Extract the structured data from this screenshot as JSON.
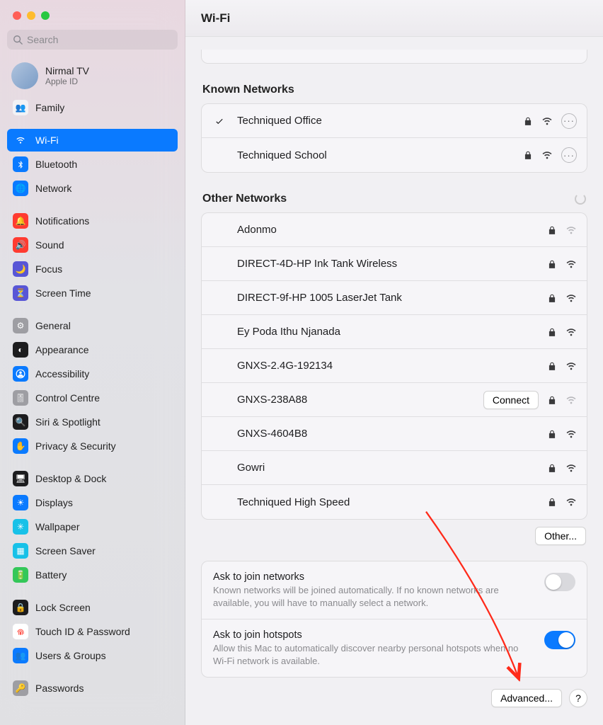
{
  "header": {
    "title": "Wi-Fi"
  },
  "search": {
    "placeholder": "Search"
  },
  "profile": {
    "name": "Nirmal TV",
    "sub": "Apple ID"
  },
  "sidebar": {
    "groups": [
      [
        {
          "label": "Family",
          "bg": "#f2f2f5",
          "fg": "#0a7aff",
          "glyph": "👥"
        }
      ],
      [
        {
          "label": "Wi-Fi",
          "bg": "#0a7aff",
          "glyph": "wifi",
          "selected": true
        },
        {
          "label": "Bluetooth",
          "bg": "#0a7aff",
          "glyph": "bt"
        },
        {
          "label": "Network",
          "bg": "#0a7aff",
          "glyph": "🌐"
        }
      ],
      [
        {
          "label": "Notifications",
          "bg": "#ff3b30",
          "glyph": "🔔"
        },
        {
          "label": "Sound",
          "bg": "#ff3b30",
          "glyph": "🔊"
        },
        {
          "label": "Focus",
          "bg": "#5856d6",
          "glyph": "🌙"
        },
        {
          "label": "Screen Time",
          "bg": "#5856d6",
          "glyph": "⏳"
        }
      ],
      [
        {
          "label": "General",
          "bg": "#9e9ea3",
          "glyph": "⚙︎"
        },
        {
          "label": "Appearance",
          "bg": "#1c1c1e",
          "glyph": "◐"
        },
        {
          "label": "Accessibility",
          "bg": "#0a7aff",
          "glyph": "person"
        },
        {
          "label": "Control Centre",
          "bg": "#9e9ea3",
          "glyph": "🎚"
        },
        {
          "label": "Siri & Spotlight",
          "bg": "#1c1c1e",
          "glyph": "🔍"
        },
        {
          "label": "Privacy & Security",
          "bg": "#0a7aff",
          "glyph": "✋"
        }
      ],
      [
        {
          "label": "Desktop & Dock",
          "bg": "#1c1c1e",
          "glyph": "🖥"
        },
        {
          "label": "Displays",
          "bg": "#0a7aff",
          "glyph": "☀︎"
        },
        {
          "label": "Wallpaper",
          "bg": "#17c1e8",
          "glyph": "✳︎"
        },
        {
          "label": "Screen Saver",
          "bg": "#17c1e8",
          "glyph": "▦"
        },
        {
          "label": "Battery",
          "bg": "#34c759",
          "glyph": "🔋"
        }
      ],
      [
        {
          "label": "Lock Screen",
          "bg": "#1c1c1e",
          "glyph": "🔒"
        },
        {
          "label": "Touch ID & Password",
          "bg": "#ffffff",
          "fg": "#ff3b30",
          "glyph": "finger"
        },
        {
          "label": "Users & Groups",
          "bg": "#0a7aff",
          "glyph": "👥"
        }
      ],
      [
        {
          "label": "Passwords",
          "bg": "#9e9ea3",
          "glyph": "🔑"
        }
      ]
    ]
  },
  "known": {
    "title": "Known Networks",
    "items": [
      {
        "name": "Techniqued Office",
        "connected": true,
        "locked": true,
        "strength": "full"
      },
      {
        "name": "Techniqued School",
        "connected": false,
        "locked": true,
        "strength": "full"
      }
    ]
  },
  "other": {
    "title": "Other Networks",
    "items": [
      {
        "name": "Adonmo",
        "locked": true,
        "strength": "dim"
      },
      {
        "name": "DIRECT-4D-HP Ink Tank Wireless",
        "locked": true,
        "strength": "full"
      },
      {
        "name": "DIRECT-9f-HP 1005 LaserJet Tank",
        "locked": true,
        "strength": "full"
      },
      {
        "name": "Ey Poda Ithu Njanada",
        "locked": true,
        "strength": "full"
      },
      {
        "name": "GNXS-2.4G-192134",
        "locked": true,
        "strength": "full"
      },
      {
        "name": "GNXS-238A88",
        "locked": true,
        "strength": "dim",
        "connectBtn": true
      },
      {
        "name": "GNXS-4604B8",
        "locked": true,
        "strength": "full"
      },
      {
        "name": "Gowri",
        "locked": true,
        "strength": "full"
      },
      {
        "name": "Techniqued High Speed",
        "locked": true,
        "strength": "full"
      }
    ]
  },
  "buttons": {
    "connect": "Connect",
    "other": "Other...",
    "advanced": "Advanced...",
    "help": "?"
  },
  "settings": {
    "ask_networks": {
      "title": "Ask to join networks",
      "desc": "Known networks will be joined automatically. If no known networks are available, you will have to manually select a network.",
      "on": false
    },
    "ask_hotspots": {
      "title": "Ask to join hotspots",
      "desc": "Allow this Mac to automatically discover nearby personal hotspots when no Wi-Fi network is available.",
      "on": true
    }
  }
}
